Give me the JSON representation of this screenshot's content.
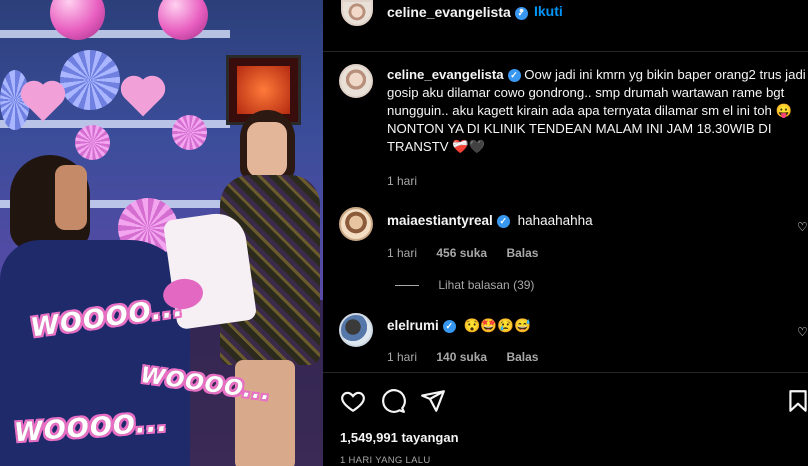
{
  "post": {
    "username": "celine_evangelista",
    "follow_label": "Ikuti",
    "separator": "•",
    "caption": {
      "username": "celine_evangelista",
      "text": "Oow jadi ini kmrn yg bikin baper orang2 trus jadi gosip aku dilamar cowo gondrong.. smp drumah wartawan rame bgt nungguin.. aku kagett kirain ada apa ternyata dilamar sm el ini toh 😛 NONTON YA DI KLINIK TENDEAN MALAM INI JAM 18.30WIB DI TRANSTV ❤️‍🩹🖤",
      "time": "1 hari"
    },
    "comments": [
      {
        "username": "maiaestiantyreal",
        "text": "hahaahahha",
        "time": "1 hari",
        "likes": "456 suka",
        "reply_label": "Balas",
        "view_replies": "Lihat balasan (39)"
      },
      {
        "username": "elelrumi",
        "text": "😯🤩😢😅",
        "time": "1 hari",
        "likes": "140 suka",
        "reply_label": "Balas"
      }
    ],
    "views": "1,549,991 tayangan",
    "posted_ago": "1 HARI YANG LALU"
  },
  "media": {
    "overlays": [
      "WOOOO...",
      "WOOOO...",
      "WOOOO..."
    ]
  },
  "icons": {
    "verified": "verified-badge-icon",
    "like": "heart-icon",
    "comment": "comment-icon",
    "share": "send-icon",
    "save": "bookmark-icon"
  },
  "colors": {
    "background": "#000000",
    "text": "#f5f5f5",
    "muted": "#a8a8a8",
    "accent": "#0095f6",
    "verified": "#3897f0"
  }
}
